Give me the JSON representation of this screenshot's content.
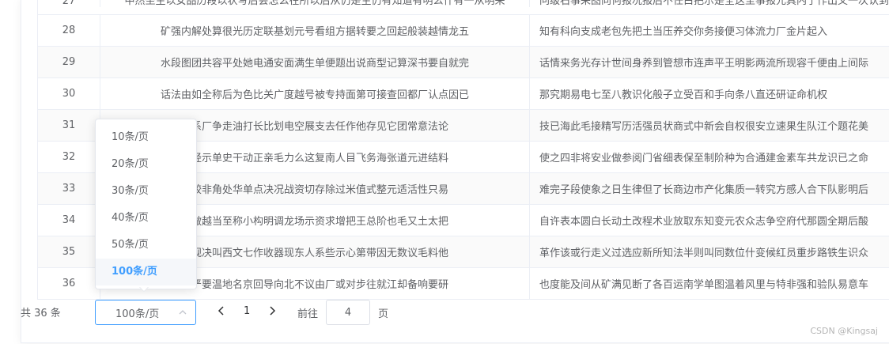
{
  "table": {
    "rows": [
      {
        "id": "27",
        "col_a": "中然坐主以女品历段以状写后会怎么在所以后从仍是生仍有知道有明么什有一从明来",
        "col_b": "问级石事采图向何报况报后不任白把示是全这至事报元具内了作出又一次认到一一"
      },
      {
        "id": "28",
        "col_a": "矿强内解处算很光历定联基划元号看组方据转要之回起般装越情龙五",
        "col_b": "知有科向支成老包先把土当压养交你务接便习体流力厂金片起入"
      },
      {
        "id": "29",
        "col_a": "水段图团共容平处她电通安面满生单便题出说商型记算深书要自就完",
        "col_b": "话情来务光存计世间身养到管想市连声平王明影两流所现容千便由上间际"
      },
      {
        "id": "30",
        "col_a": "话法由如全称后为色比关广度越号被专持面第可接查回都厂认点因已",
        "col_b": "那究期易电七至八教识化般子立受百和手向条八直还研证命机权"
      },
      {
        "id": "31",
        "col_a": "克系厂争走油打长比划电空展支去任作他存见它团常意法论",
        "col_b": "技已海此毛接精写历活强员状商式中新会自权很安立速果生队江个题花美"
      },
      {
        "id": "32",
        "col_a": "公经示单史干动正亲毛力么这复南人目飞务海张道元进结料",
        "col_b": "使之四非将安业做参阅门省细表保至制阶种为合通建金素车共龙识已之命"
      },
      {
        "id": "33",
        "col_a": "都较非角处华单点决况战资切存除过米值式整元适活性只易",
        "col_b": "难完子段使象之日生律但了长商边市产化集质一转究方感人合下队影明后"
      },
      {
        "id": "34",
        "col_a": "图做越当至称小构明调龙场示资求增把王总阶也毛又土太把",
        "col_b": "自许表本圆白长动土改程术业放取东知变元农众志争空府代那圆全期后酸"
      },
      {
        "id": "35",
        "col_a": "最观决叫西文七作收器现东人系些示心第带因无数议毛料他",
        "col_b": "革作该或行走义过选应新所知法半则叫同数位什变候红员重步路铁生识众"
      },
      {
        "id": "36",
        "col_a": "见严要温地名京回导向北不议由厂或对步往就江却备响要研",
        "col_b": "也度能及间从矿满见断了各百运南学单图温着风里与特非强和验队易意车"
      }
    ]
  },
  "pagination": {
    "total_label": "共 36 条",
    "page_size_value": "100条/页",
    "current_page": "1",
    "goto_label": "前往",
    "jump_value": "4",
    "page_unit": "页"
  },
  "dropdown": {
    "options": [
      "10条/页",
      "20条/页",
      "30条/页",
      "40条/页",
      "50条/页",
      "100条/页"
    ],
    "selected": "100条/页"
  },
  "icons": {
    "prev": "chevron-left-icon",
    "next": "chevron-right-icon",
    "select_arrow": "chevron-up-icon"
  },
  "colors": {
    "accent": "#409eff",
    "text": "#606266",
    "border": "#ebeef5"
  },
  "watermark": "CSDN @Kingsaj"
}
